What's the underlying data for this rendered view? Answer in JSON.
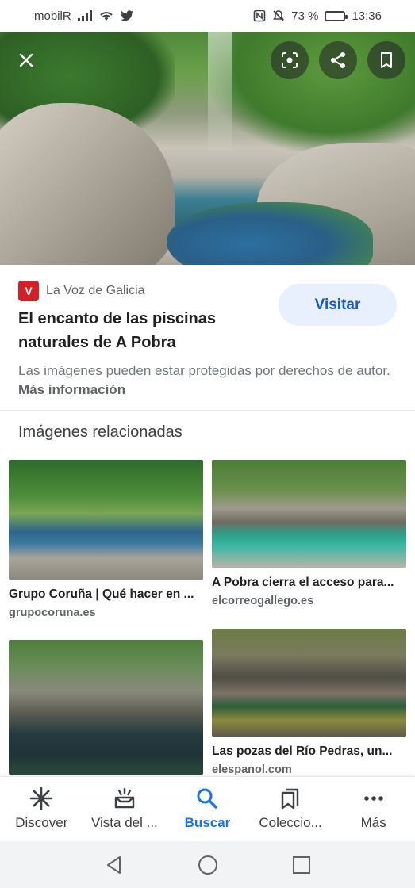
{
  "status_bar": {
    "carrier": "mobilR",
    "battery_percent": "73 %",
    "battery_level": 0.73,
    "time": "13:36",
    "icons": [
      "signal-icon",
      "wifi-icon",
      "twitter-icon",
      "nfc-icon",
      "mute-icon",
      "battery-icon"
    ]
  },
  "hero": {
    "buttons": [
      "close-icon",
      "lens-icon",
      "share-icon",
      "bookmark-icon"
    ]
  },
  "source": {
    "site_name": "La Voz de Galicia",
    "title": "El encanto de las piscinas naturales de A Pobra",
    "visit_label": "Visitar",
    "copyright_text": "Las imágenes pueden estar protegidas por derechos de autor.",
    "more_info_label": "Más información"
  },
  "related": {
    "heading": "Imágenes relacionadas",
    "items": [
      {
        "caption": "Grupo Coruña | Qué hacer en ...",
        "domain": "grupocoruna.es"
      },
      {
        "caption": "A Pobra cierra el acceso para...",
        "domain": "elcorreogallego.es"
      },
      {
        "caption": "",
        "domain": ""
      },
      {
        "caption": "Las pozas del Río Pedras, un...",
        "domain": "elespanol.com"
      }
    ]
  },
  "bottom_nav": {
    "items": [
      {
        "label": "Discover",
        "icon": "asterisk-icon"
      },
      {
        "label": "Vista del ...",
        "icon": "updates-icon"
      },
      {
        "label": "Buscar",
        "icon": "search-icon"
      },
      {
        "label": "Coleccio...",
        "icon": "collections-icon"
      },
      {
        "label": "Más",
        "icon": "more-icon"
      }
    ],
    "active_index": 2,
    "active_color": "#1a73e8"
  },
  "system_nav": {
    "buttons": [
      "back-icon",
      "home-icon",
      "recents-icon"
    ]
  }
}
